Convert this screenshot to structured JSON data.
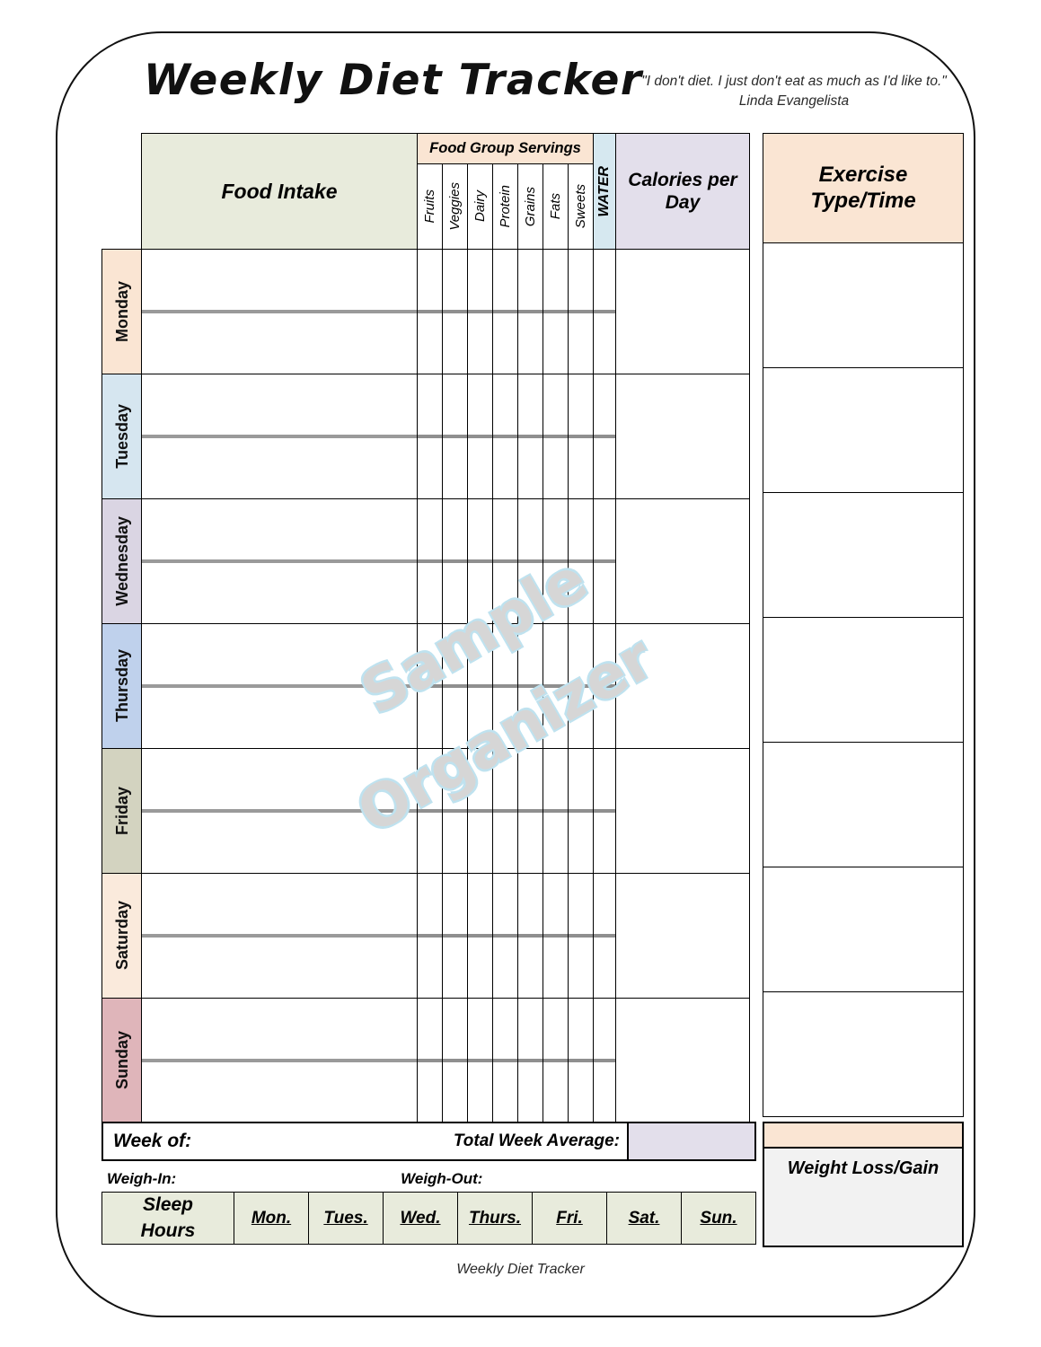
{
  "page": {
    "title": "Weekly Diet Tracker",
    "footer": "Weekly Diet Tracker",
    "watermark_line1": "Sample",
    "watermark_line2": "Organizer"
  },
  "quote": {
    "text": "\"I don't diet. I just don't eat as much as I'd like to.\"",
    "author": "Linda Evangelista"
  },
  "headers": {
    "food_intake": "Food Intake",
    "food_group_servings": "Food Group Servings",
    "water": "WATER",
    "calories_per_day": "Calories per Day",
    "exercise": "Exercise Type/Time"
  },
  "food_groups": [
    "Fruits",
    "Veggies",
    "Dairy",
    "Protein",
    "Grains",
    "Fats",
    "Sweets"
  ],
  "days": [
    {
      "label": "Monday",
      "color": "#FAE5D3"
    },
    {
      "label": "Tuesday",
      "color": "#D6E6F0"
    },
    {
      "label": "Wednesday",
      "color": "#DAD5E3"
    },
    {
      "label": "Thursday",
      "color": "#BFD1EC"
    },
    {
      "label": "Friday",
      "color": "#D3D3C0"
    },
    {
      "label": "Saturday",
      "color": "#FAEADC"
    },
    {
      "label": "Sunday",
      "color": "#DFB5BA"
    }
  ],
  "summary": {
    "week_of": "Week of:",
    "total_week_average": "Total Week Average:",
    "weigh_in": "Weigh-In:",
    "weigh_out": "Weigh-Out:",
    "weight_loss_gain": "Weight Loss/Gain"
  },
  "sleep": {
    "label": "Sleep Hours",
    "label_line1": "Sleep",
    "label_line2": "Hours",
    "day_abbrevs": [
      "Mon.",
      "Tues.",
      "Wed.",
      "Thurs.",
      "Fri.",
      "Sat.",
      "Sun."
    ]
  },
  "colors": {
    "food_intake_header": "#E8EBDC",
    "food_group_header": "#FAE5D3",
    "water_header": "#D6E8F0",
    "calories_header": "#E3DFEB",
    "exercise_header": "#FAE5D3",
    "sleep_cells": "#E8EBDC",
    "weight_box": "#F2F2F2",
    "watermark": "#D6D6D6",
    "watermark_outline": "#BFE2EF"
  }
}
